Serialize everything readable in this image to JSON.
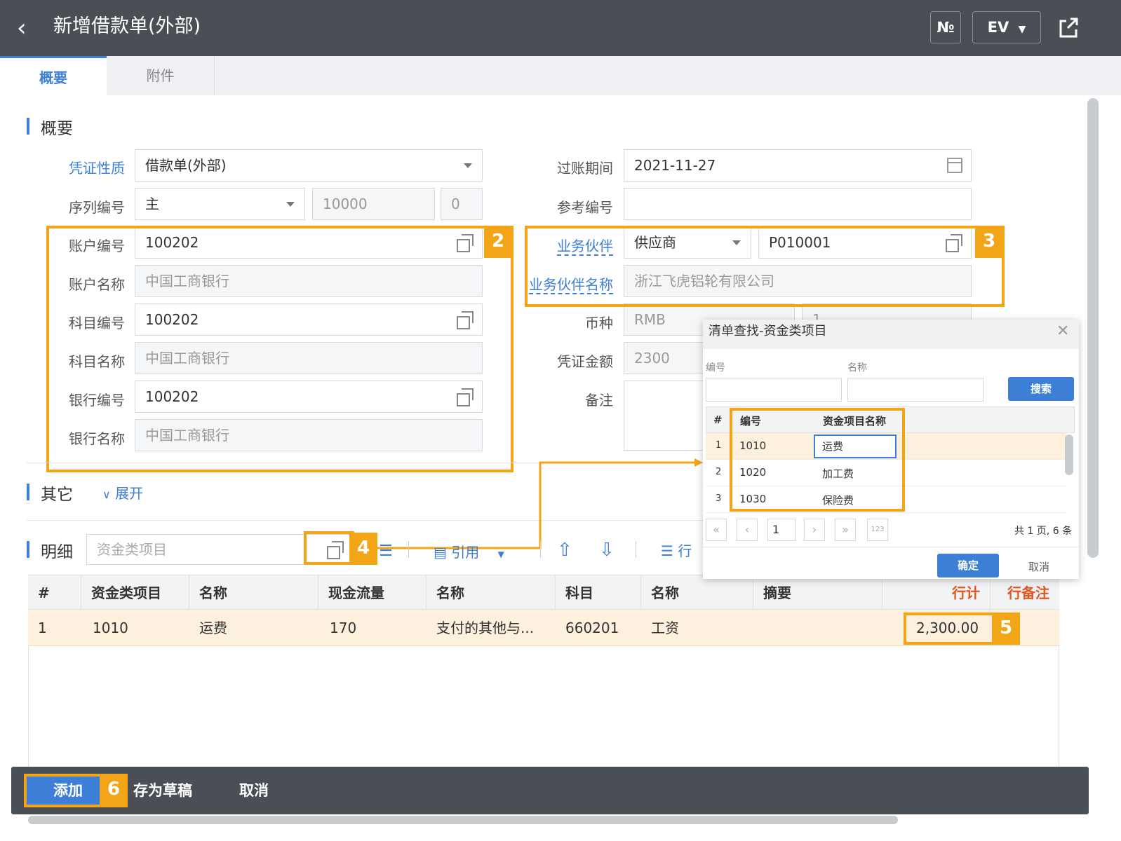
{
  "header": {
    "title": "新增借款单(外部)",
    "btn_no": "№",
    "btn_ev": "EV"
  },
  "tabs": [
    {
      "label": "概要"
    },
    {
      "label": "附件"
    }
  ],
  "summary": {
    "section_title": "概要",
    "voucher_type": {
      "label": "凭证性质",
      "value": "借款单(外部)"
    },
    "serial": {
      "label": "序列编号",
      "value": "主",
      "number": "10000",
      "suffix": "0"
    },
    "account_no": {
      "label": "账户编号",
      "value": "100202"
    },
    "account_name": {
      "label": "账户名称",
      "value": "中国工商银行"
    },
    "subject_no": {
      "label": "科目编号",
      "value": "100202"
    },
    "subject_name": {
      "label": "科目名称",
      "value": "中国工商银行"
    },
    "bank_no": {
      "label": "银行编号",
      "value": "100202"
    },
    "bank_name": {
      "label": "银行名称",
      "value": "中国工商银行"
    },
    "posting_date": {
      "label": "过账期间",
      "value": "2021-11-27"
    },
    "reference_no": {
      "label": "参考编号",
      "value": ""
    },
    "partner": {
      "label": "业务伙伴",
      "type": "供应商",
      "value": "P010001"
    },
    "partner_name": {
      "label": "业务伙伴名称",
      "value": "浙江飞虎铝轮有限公司"
    },
    "currency": {
      "label": "币种",
      "value": "RMB",
      "rate": "1"
    },
    "amount": {
      "label": "凭证金额",
      "value": "2300"
    },
    "remark": {
      "label": "备注",
      "value": ""
    }
  },
  "other": {
    "section_title": "其它",
    "expand": "展开"
  },
  "detail": {
    "section_title": "明细",
    "input_placeholder": "资金类项目",
    "toolbar": {
      "quote": "引用",
      "row": "行"
    },
    "columns": [
      "#",
      "资金类项目",
      "名称",
      "现金流量",
      "名称",
      "科目",
      "名称",
      "摘要",
      "行计",
      "行备注"
    ],
    "rows": [
      {
        "idx": "1",
        "fund_item": "1010",
        "fund_name": "运费",
        "cashflow": "170",
        "cashflow_name": "支付的其他与...",
        "subject": "660201",
        "subject_name": "工资",
        "summary": "",
        "total": "2,300.00",
        "note": ""
      }
    ]
  },
  "dialog": {
    "title": "清单查找-资金类项目",
    "code_label": "编号",
    "name_label": "名称",
    "search": "搜索",
    "columns": [
      "#",
      "编号",
      "资金项目名称"
    ],
    "rows": [
      {
        "idx": "1",
        "code": "1010",
        "name": "运费"
      },
      {
        "idx": "2",
        "code": "1020",
        "name": "加工费"
      },
      {
        "idx": "3",
        "code": "1030",
        "name": "保险费"
      }
    ],
    "page": "1",
    "page_summary": "共 1 页, 6 条",
    "ok": "确定",
    "cancel": "取消"
  },
  "badges": [
    "2",
    "3",
    "4",
    "5",
    "6"
  ],
  "footer": {
    "add": "添加",
    "draft": "存为草稿",
    "cancel": "取消"
  },
  "colors": {
    "accent": "#3d7fd6",
    "highlight": "#f2a516",
    "header_bg": "#4a4f55",
    "row_selected": "#fdf0dc",
    "red_header": "#e2541d"
  }
}
